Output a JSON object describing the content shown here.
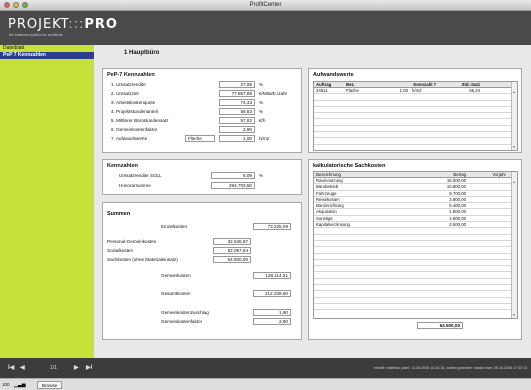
{
  "window": {
    "title": "ProfitCenter"
  },
  "brand": {
    "logo_main": "PROJEKT",
    "logo_sep": ":::",
    "logo_end": "PRO",
    "tagline": "the business solution for architects"
  },
  "sidebar": {
    "items": [
      {
        "label": "Dateiblatt"
      },
      {
        "label": "PeP 7 Kennzahlen"
      }
    ]
  },
  "page": {
    "title": "1  Hauptbüro"
  },
  "pep7": {
    "title": "PeP-7 Kennzahlen",
    "rows": [
      {
        "label": "1. Umsatzrendite",
        "value": "27,95",
        "unit": "%"
      },
      {
        "label": "2. Umsatzziel",
        "value": "77.857,85",
        "unit": "€/Mitarb./Jahr"
      },
      {
        "label": "3. Arbeitskostenquote",
        "value": "74,33",
        "unit": "%"
      },
      {
        "label": "4. Projektstundenanteil",
        "value": "58,63",
        "unit": "%"
      },
      {
        "label": "5. Mittlerer Bürostundensatz",
        "value": "57,82",
        "unit": "€/h"
      },
      {
        "label": "6. Gemeinkostenfaktor",
        "value": "2,90",
        "unit": ""
      },
      {
        "label": "7. Aufwandswerte",
        "value": "1,00",
        "unit": "h/m2",
        "extra": "Fläche"
      }
    ]
  },
  "aufwand": {
    "title": "Aufwandswerte",
    "headers": [
      "Auftrag",
      "Bez.",
      "Kennzahl 7",
      "Std.-Satz"
    ],
    "rows": [
      {
        "auftrag": "24511",
        "bez": "Fläche",
        "k7": "1,00",
        "unit": "h/m2",
        "satz": "65,44"
      }
    ]
  },
  "kennzahlen": {
    "title": "Kennzahlen",
    "rows": [
      {
        "label": "Umsatzrendite SOLL",
        "value": "8,09",
        "unit": "%"
      },
      {
        "label": "Honorarsumme",
        "value": "294.703,50",
        "unit": ""
      }
    ]
  },
  "summen": {
    "title": "Summen",
    "einzel": {
      "label": "Einzelkosten",
      "value": "73.225,09"
    },
    "left_rows": [
      {
        "label": "Personal-Gemeinkosten",
        "value": "32.546,97"
      },
      {
        "label": "Sozialkosten",
        "value": "52.067,54"
      },
      {
        "label": "Sachkosten (ohne Materialeinsatz)",
        "value": "54.500,00"
      }
    ],
    "right_rows": [
      {
        "label": "Gemeinkosten",
        "value": "139.114,51"
      },
      {
        "label": "Gesamtkosten",
        "value": "212.339,60"
      },
      {
        "label": "Gemeinkostenzuschlag",
        "value": "1,90"
      },
      {
        "label": "Gemeinkostenfaktor",
        "value": "2,90"
      }
    ]
  },
  "sach": {
    "title": "kalkulatorische Sachkosten",
    "headers": [
      "Bezeichnung",
      "Betrag",
      "Vorjahr"
    ],
    "rows": [
      {
        "name": "Raumnutzung",
        "betrag": "16.000,00"
      },
      {
        "name": "Bürobetrieb",
        "betrag": "10.800,00"
      },
      {
        "name": "Fahrzeuge",
        "betrag": "8.700,00"
      },
      {
        "name": "Reisekosten",
        "betrag": "3.800,00"
      },
      {
        "name": "Büroinrichtung",
        "betrag": "5.400,00"
      },
      {
        "name": "Akquisition",
        "betrag": "1.800,00"
      },
      {
        "name": "Sonstige",
        "betrag": "4.500,00"
      },
      {
        "name": "Kapitalverzinsung",
        "betrag": "3.500,00"
      }
    ],
    "total": "54.500,00"
  },
  "status": {
    "nav_first": "I◀",
    "nav_prev": "◀",
    "record": "1/1",
    "nav_next": "▶",
    "nav_last": "▶I",
    "edit_info": "erstellt: matthias jüstel, 13.08.2006 16:33:18, zuletzt geändert: harald marr, 06.10.2006 17:33:13"
  },
  "bottom": {
    "zoom": "100",
    "zoom_icons": "▁▃▅",
    "mode": "Browse"
  }
}
